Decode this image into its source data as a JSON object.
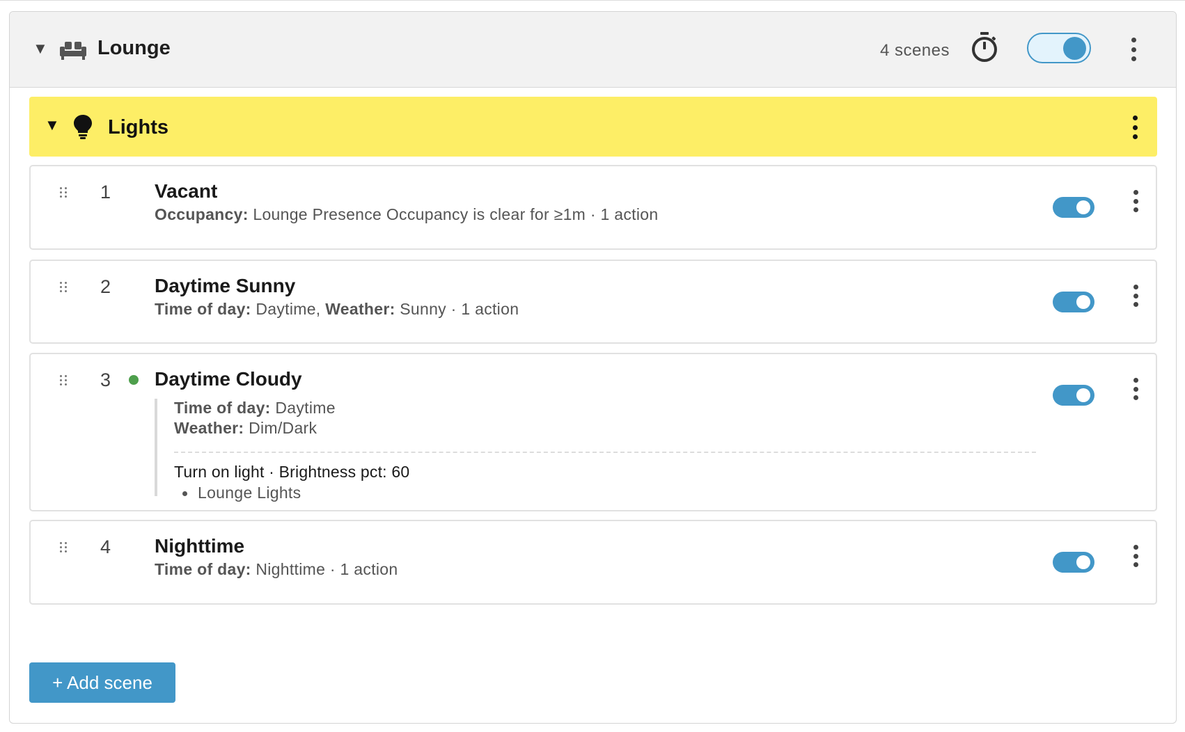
{
  "room": {
    "name": "Lounge",
    "icon": "sofa-icon",
    "scene_count": "4 scenes",
    "enabled": true
  },
  "group": {
    "name": "Lights",
    "icon": "lightbulb-icon",
    "color": "#fdee66"
  },
  "scenes": [
    {
      "index": "1",
      "name": "Vacant",
      "active": false,
      "enabled": true,
      "summary_label": "Occupancy:",
      "summary_text": " Lounge Presence Occupancy is clear for ≥1m · 1 action"
    },
    {
      "index": "2",
      "name": "Daytime Sunny",
      "active": false,
      "enabled": true,
      "summary_label": "Time of day:",
      "summary_value": " Daytime, ",
      "summary_label2": "Weather:",
      "summary_text": " Sunny · 1 action"
    },
    {
      "index": "3",
      "name": "Daytime Cloudy",
      "active": true,
      "enabled": true,
      "conditions": [
        {
          "label": "Time of day:",
          "value": " Daytime"
        },
        {
          "label": "Weather:",
          "value": " Dim/Dark"
        }
      ],
      "action": "Turn on light · Brightness pct: 60",
      "targets": [
        "Lounge Lights"
      ]
    },
    {
      "index": "4",
      "name": "Nighttime",
      "active": false,
      "enabled": true,
      "summary_label": "Time of day:",
      "summary_text": " Nighttime · 1 action"
    }
  ],
  "add_button_label": "+ Add scene",
  "colors": {
    "accent": "#4297c8",
    "active_dot": "#4e9f4c",
    "header_bg": "#f2f2f2"
  }
}
